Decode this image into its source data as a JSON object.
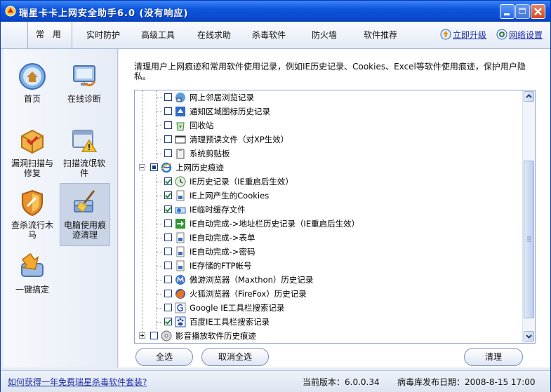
{
  "window": {
    "title": "瑞星卡卡上网安全助手6.0 (没有响应)"
  },
  "menu": {
    "items": [
      "常 用",
      "实时防护",
      "高级工具",
      "在线求助",
      "杀毒软件",
      "防火墙",
      "软件推荐"
    ],
    "upgrade": "立即升级",
    "network": "网络设置"
  },
  "sidebar": {
    "items": [
      "首页",
      "在线诊断",
      "漏洞扫描与修复",
      "扫描流氓软件",
      "查杀流行木马",
      "电脑使用痕迹清理",
      "一键搞定"
    ]
  },
  "content": {
    "description": "清理用户上网痕迹和常用软件使用记录，例如IE历史记录、Cookies、Excel等软件使用痕迹，保护用户隐私。",
    "tree": [
      {
        "label": "网上邻居浏览记录",
        "checked": false,
        "level": 2,
        "icon": "network-places-icon"
      },
      {
        "label": "通知区域图标历史记录",
        "checked": false,
        "level": 2,
        "icon": "tray-icon"
      },
      {
        "label": "回收站",
        "checked": false,
        "level": 2,
        "icon": "recycle-bin-icon"
      },
      {
        "label": "清理预读文件（对XP生效）",
        "checked": false,
        "level": 2,
        "icon": "window-icon"
      },
      {
        "label": "系统剪贴板",
        "checked": false,
        "level": 2,
        "icon": "clipboard-icon"
      },
      {
        "label": "上网历史痕迹",
        "checked": "partial",
        "level": 1,
        "icon": "ie-icon",
        "expanded": true
      },
      {
        "label": "IE历史记录（IE重启后生效）",
        "checked": true,
        "level": 2,
        "icon": "history-icon"
      },
      {
        "label": "IE上网产生的Cookies",
        "checked": true,
        "level": 2,
        "icon": "cookie-icon"
      },
      {
        "label": "IE临时缓存文件",
        "checked": true,
        "level": 2,
        "icon": "cache-icon"
      },
      {
        "label": "IE自动完成->地址栏历史记录（IE重启后生效）",
        "checked": false,
        "level": 2,
        "icon": "go-arrow-icon"
      },
      {
        "label": "IE自动完成->表单",
        "checked": false,
        "level": 2,
        "icon": "form-icon"
      },
      {
        "label": "IE自动完成->密码",
        "checked": false,
        "level": 2,
        "icon": "password-icon"
      },
      {
        "label": "IE存储的FTP帐号",
        "checked": false,
        "level": 2,
        "icon": "ftp-icon"
      },
      {
        "label": "傲游浏览器（Maxthon）历史记录",
        "checked": false,
        "level": 2,
        "icon": "maxthon-icon"
      },
      {
        "label": "火狐浏览器（FireFox）历史记录",
        "checked": false,
        "level": 2,
        "icon": "firefox-icon"
      },
      {
        "label": "Google IE工具栏搜索记录",
        "checked": false,
        "level": 2,
        "icon": "google-icon"
      },
      {
        "label": "百度IE工具栏搜索记录",
        "checked": true,
        "level": 2,
        "icon": "baidu-icon"
      },
      {
        "label": "影音播放软件历史痕迹",
        "checked": false,
        "level": 1,
        "icon": "media-icon",
        "expanded": false
      }
    ],
    "select_all": "全选",
    "deselect_all": "取消全选",
    "clean": "清理"
  },
  "status": {
    "link": "如何获得一年免费瑞星杀毒软件套装?",
    "version": "当前版本：6.0.0.34",
    "db_date": "病毒库发布日期：2008-8-15 17:00"
  },
  "colors": {
    "title_blue": "#0a4bd0",
    "link_blue": "#1a2aa8",
    "check_green": "#1f8a1f"
  }
}
